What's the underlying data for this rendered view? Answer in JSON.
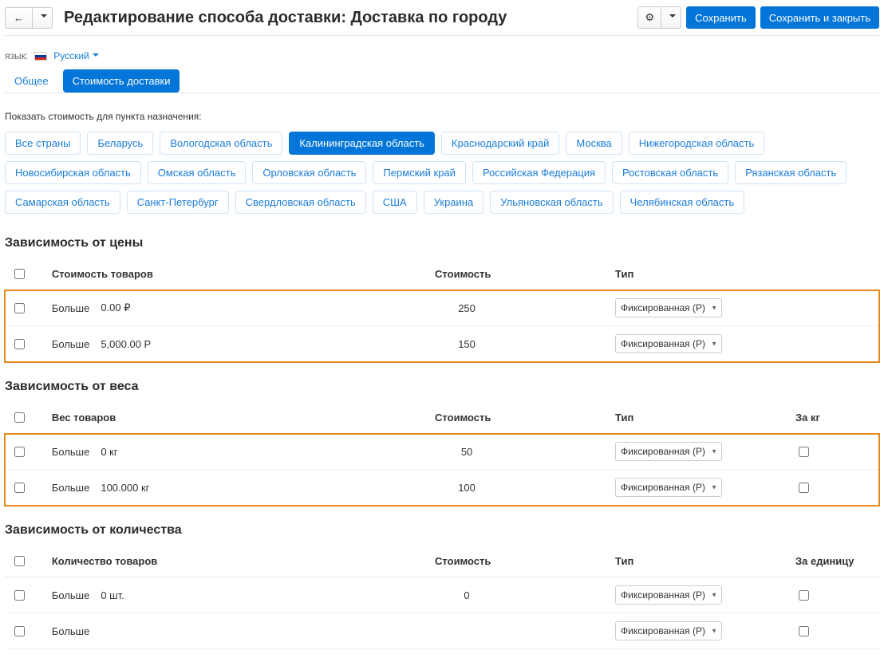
{
  "header": {
    "title": "Редактирование способа доставки: Доставка по городу",
    "save": "Сохранить",
    "save_close": "Сохранить и закрыть"
  },
  "language": {
    "label": "язык:",
    "value": "Русский"
  },
  "tabs": {
    "general": "Общее",
    "shipping_cost": "Стоимость доставки"
  },
  "destinations": {
    "label": "Показать стоимость для пункта назначения:",
    "items": [
      "Все страны",
      "Беларусь",
      "Вологодская область",
      "Калининградская область",
      "Краснодарский край",
      "Москва",
      "Нижегородская область",
      "Новосибирская область",
      "Омская область",
      "Орловская область",
      "Пермский край",
      "Российская Федерация",
      "Ростовская область",
      "Рязанская область",
      "Самарская область",
      "Санкт-Петербург",
      "Свердловская область",
      "США",
      "Украина",
      "Ульяновская область",
      "Челябинская область"
    ],
    "active_index": 3
  },
  "cols": {
    "goods_cost": "Стоимость товаров",
    "goods_weight": "Вес товаров",
    "goods_qty": "Количество товаров",
    "value": "Стоимость",
    "type": "Тип",
    "per_kg": "За кг",
    "per_unit": "За единицу"
  },
  "labels": {
    "more_than": "Больше"
  },
  "type_option": "Фиксированная (Р)",
  "price_section": {
    "title": "Зависимость от цены",
    "rows": [
      {
        "threshold": "0.00 ₽",
        "value": "250"
      },
      {
        "threshold": "5,000.00 Р",
        "value": "150"
      }
    ]
  },
  "weight_section": {
    "title": "Зависимость от веса",
    "rows": [
      {
        "threshold": "0 кг",
        "value": "50"
      },
      {
        "threshold": "100.000 кг",
        "value": "100"
      }
    ]
  },
  "qty_section": {
    "title": "Зависимость от количества",
    "rows": [
      {
        "threshold": "0 шт.",
        "value": "0"
      },
      {
        "threshold": "",
        "value": ""
      }
    ]
  }
}
